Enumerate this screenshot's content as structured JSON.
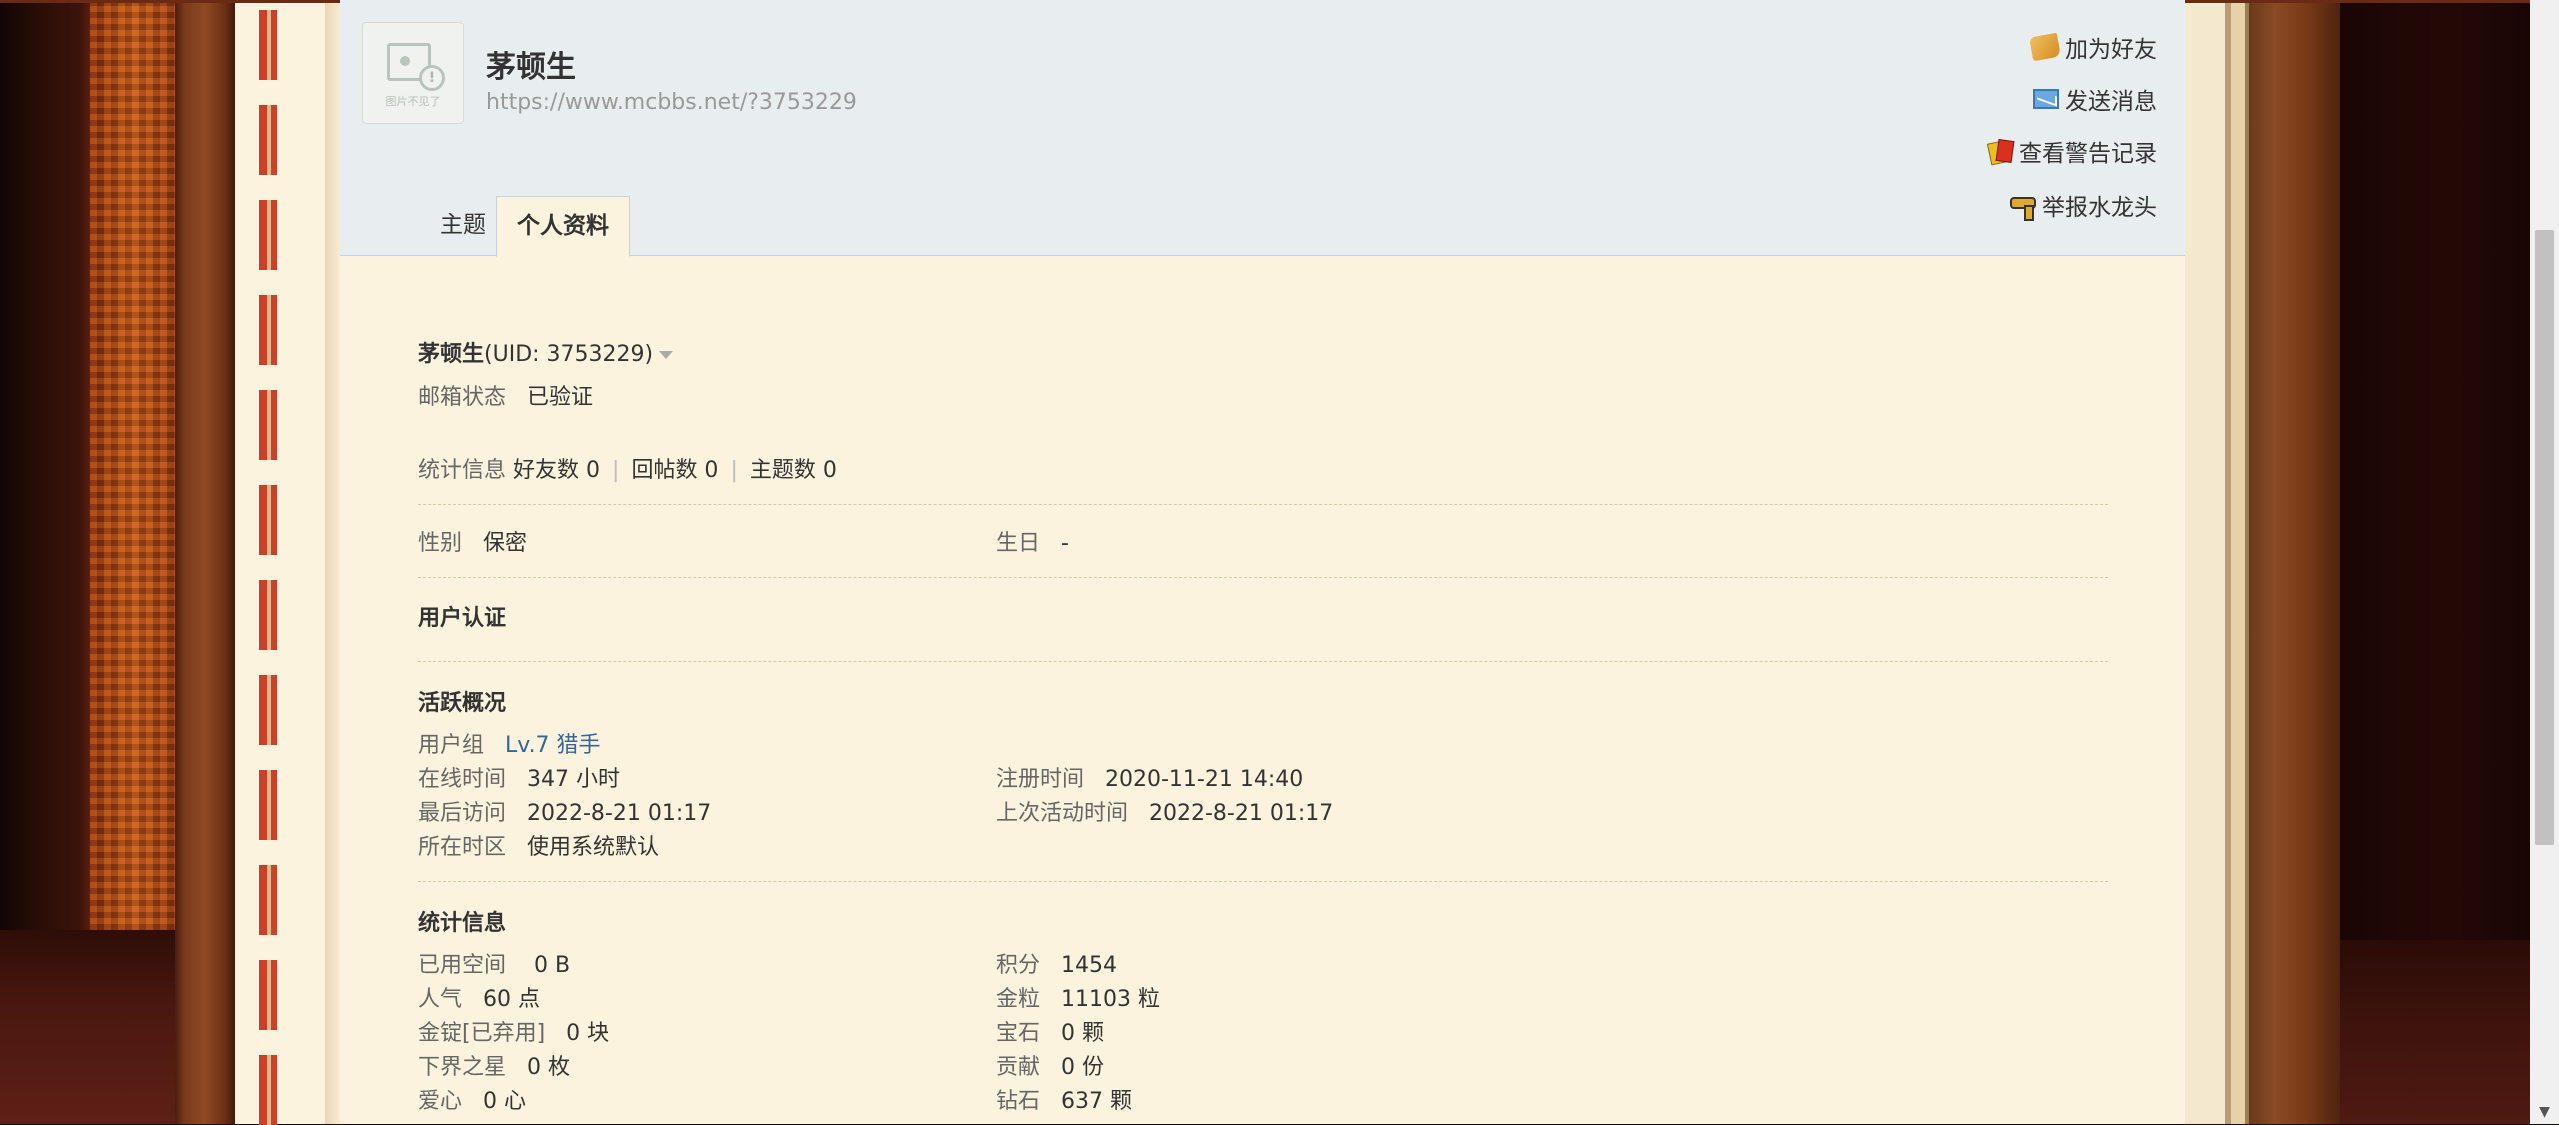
{
  "profile": {
    "name": "茅顿生",
    "url": "https://www.mcbbs.net/?3753229",
    "avatar_caption": "图片不见了"
  },
  "actions": {
    "add_friend": "加为好友",
    "send_message": "发送消息",
    "view_warnings": "查看警告记录",
    "report": "举报水龙头"
  },
  "tabs": [
    {
      "label": "主题"
    },
    {
      "label": "个人资料",
      "active": true
    }
  ],
  "info": {
    "name": "茅顿生",
    "uid": "(UID: 3753229)",
    "email_status_label": "邮箱状态",
    "email_status_value": "已验证",
    "stats_label": "统计信息",
    "friends": "好友数 0",
    "replies": "回帖数 0",
    "topics": "主题数 0",
    "gender_label": "性别",
    "gender_value": "保密",
    "birthday_label": "生日",
    "birthday_value": "-",
    "cert_title": "用户认证"
  },
  "activity": {
    "title": "活跃概况",
    "group_label": "用户组",
    "group_value": "Lv.7 猎手",
    "online_label": "在线时间",
    "online_value": "347 小时",
    "register_label": "注册时间",
    "register_value": "2020-11-21 14:40",
    "last_visit_label": "最后访问",
    "last_visit_value": "2022-8-21 01:17",
    "last_active_label": "上次活动时间",
    "last_active_value": "2022-8-21 01:17",
    "timezone_label": "所在时区",
    "timezone_value": "使用系统默认"
  },
  "statistics": {
    "title": "统计信息",
    "left": [
      {
        "label": "已用空间",
        "value": "0 B"
      },
      {
        "label": "人气",
        "value": "60 点"
      },
      {
        "label": "金锭[已弃用]",
        "value": "0 块"
      },
      {
        "label": "下界之星",
        "value": "0 枚"
      },
      {
        "label": "爱心",
        "value": "0 心"
      }
    ],
    "right": [
      {
        "label": "积分",
        "value": "1454"
      },
      {
        "label": "金粒",
        "value": "11103 粒"
      },
      {
        "label": "宝石",
        "value": "0 颗"
      },
      {
        "label": "贡献",
        "value": "0 份"
      },
      {
        "label": "钻石",
        "value": "637 颗"
      }
    ]
  }
}
